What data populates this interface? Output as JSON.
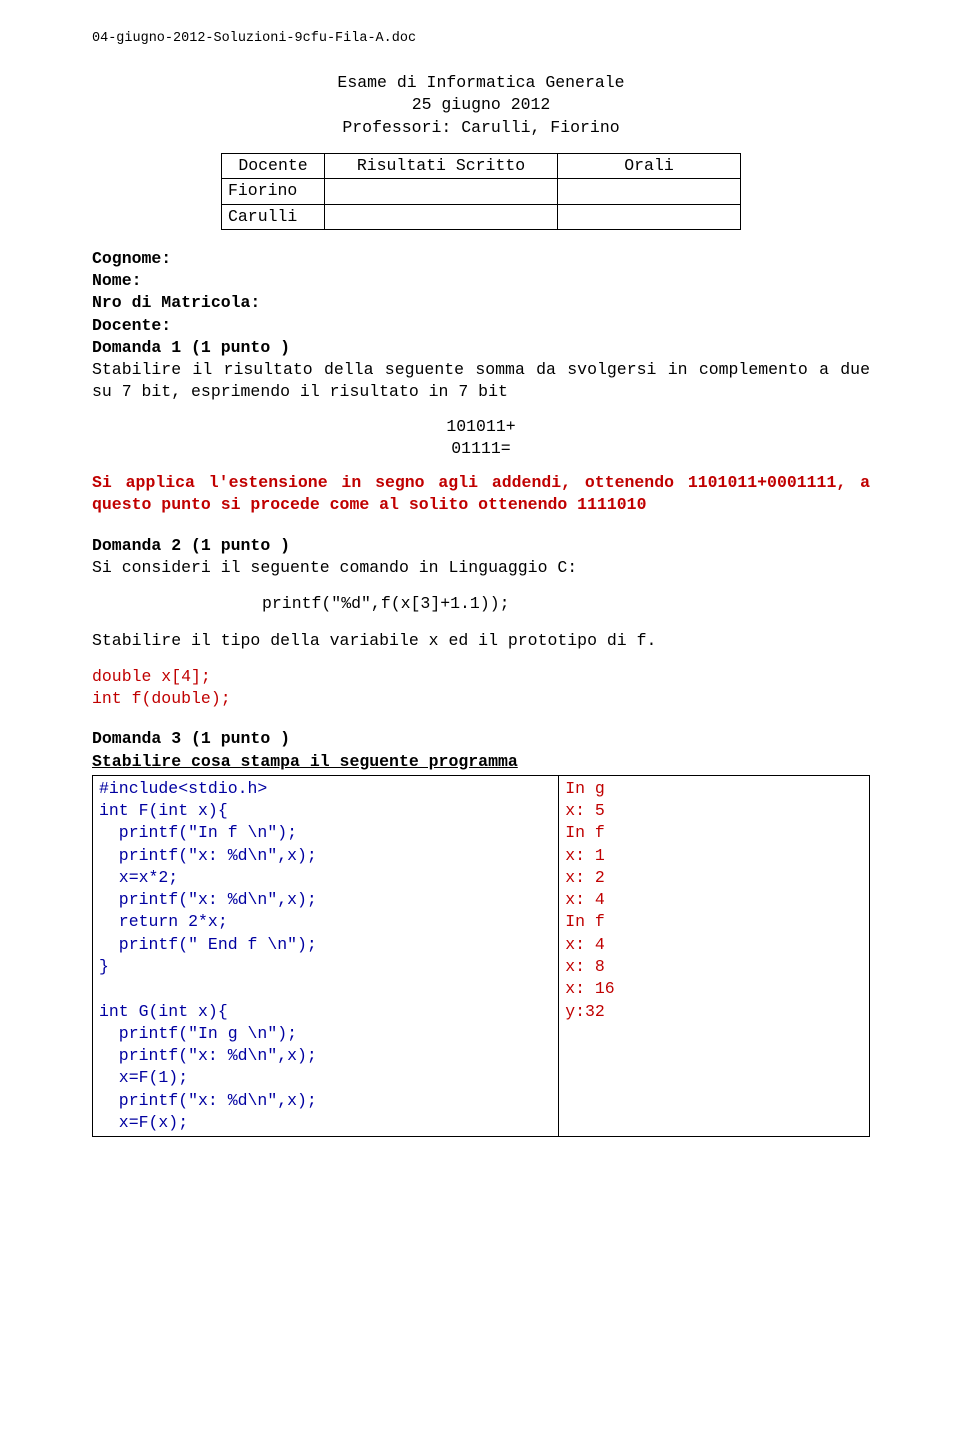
{
  "filename": "04-giugno-2012-Soluzioni-9cfu-Fila-A.doc",
  "title_line1": "Esame di Informatica Generale",
  "title_line2": "25 giugno 2012",
  "title_line3": "Professori: Carulli, Fiorino",
  "table": {
    "h1": "Docente",
    "h2": "Risultati Scritto",
    "h3": "Orali",
    "r1": "Fiorino",
    "r2": "Carulli"
  },
  "labels": {
    "cognome": "Cognome:",
    "nome": "Nome:",
    "matricola": "Nro di Matricola:",
    "docente": "Docente:"
  },
  "d1": {
    "head": "Domanda 1 (1 punto )",
    "body": "Stabilire il risultato della seguente somma da svolgersi in complemento a due su 7 bit, esprimendo il risultato in 7 bit",
    "math1": "101011+",
    "math2": "01111=",
    "sol": "Si applica l'estensione in segno agli addendi, ottenendo 1101011+0001111, a questo punto si procede come al solito ottenendo 1111010"
  },
  "d2": {
    "head": "Domanda 2 (1 punto )",
    "intro": "Si consideri il seguente comando in Linguaggio C:",
    "printf": "printf(\"%d\",f(x[3]+1.1));",
    "ask": "Stabilire il tipo della variabile x ed il prototipo di f.",
    "sol1": "double x[4];",
    "sol2": "int f(double);"
  },
  "d3": {
    "head": "Domanda 3 (1 punto )",
    "ask": "Stabilire cosa stampa il seguente programma",
    "code": "#include<stdio.h>\nint F(int x){\n  printf(\"In f \\n\");\n  printf(\"x: %d\\n\",x);\n  x=x*2;\n  printf(\"x: %d\\n\",x);\n  return 2*x;\n  printf(\" End f \\n\");\n}\n\nint G(int x){\n  printf(\"In g \\n\");\n  printf(\"x: %d\\n\",x);\n  x=F(1);\n  printf(\"x: %d\\n\",x);\n  x=F(x);",
    "output": "In g\nx: 5\nIn f\nx: 1\nx: 2\nx: 4\nIn f\nx: 4\nx: 8\nx: 16\ny:32"
  }
}
